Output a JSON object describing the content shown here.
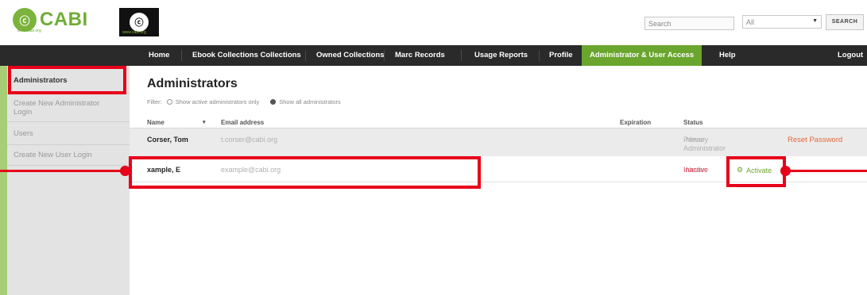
{
  "header": {
    "logo_cabi_mark": "ⓒ",
    "logo_cabi": "CABI",
    "logo_cabi_sub": "www.cabi.org",
    "logo_ebooks_sub": "www.cabi.org",
    "search_placeholder": "Search",
    "select_value": "All",
    "search_button": "SEARCH"
  },
  "nav": {
    "items": [
      "Home",
      "Ebook Collections Collections",
      "Owned Collections",
      "Marc Records",
      "Usage Reports",
      "Profile",
      "Administrator & User Access",
      "Help",
      "Logout"
    ],
    "active": "Administrator & User Access"
  },
  "sidebar": {
    "items": [
      "Administrators",
      "Create New Administrator Login",
      "Users",
      "Create New User Login"
    ]
  },
  "main": {
    "title": "Administrators",
    "filter_label": "Filter:",
    "filter_option_active": "Show active administrators only",
    "filter_option_all": "Show all administrators",
    "columns": [
      "Name",
      "Email address",
      "Expiration",
      "Status"
    ],
    "sort_indicator": "▾",
    "rows": [
      {
        "name": "Corser, Tom",
        "email": "t.corser@cabi.org",
        "expiration": "Never",
        "status": "Primary Administrator",
        "action": "Reset Password"
      },
      {
        "name": "xample, E",
        "email": "example@cabi.org",
        "expiration": "Never",
        "status": "Inactive",
        "action": "Activate"
      }
    ]
  },
  "colors": {
    "brand_green": "#6aa52e",
    "nav_dark": "#2a2a2a",
    "annotation_red": "#e8001a",
    "inactive_red": "#d9304a",
    "reset_orange": "#e06a3c"
  },
  "icons": [
    "cabi-logo-icon",
    "cabi-ebooks-logo-icon",
    "dropdown-caret-icon",
    "sort-caret-icon",
    "radio-icon",
    "activate-gear-icon"
  ]
}
